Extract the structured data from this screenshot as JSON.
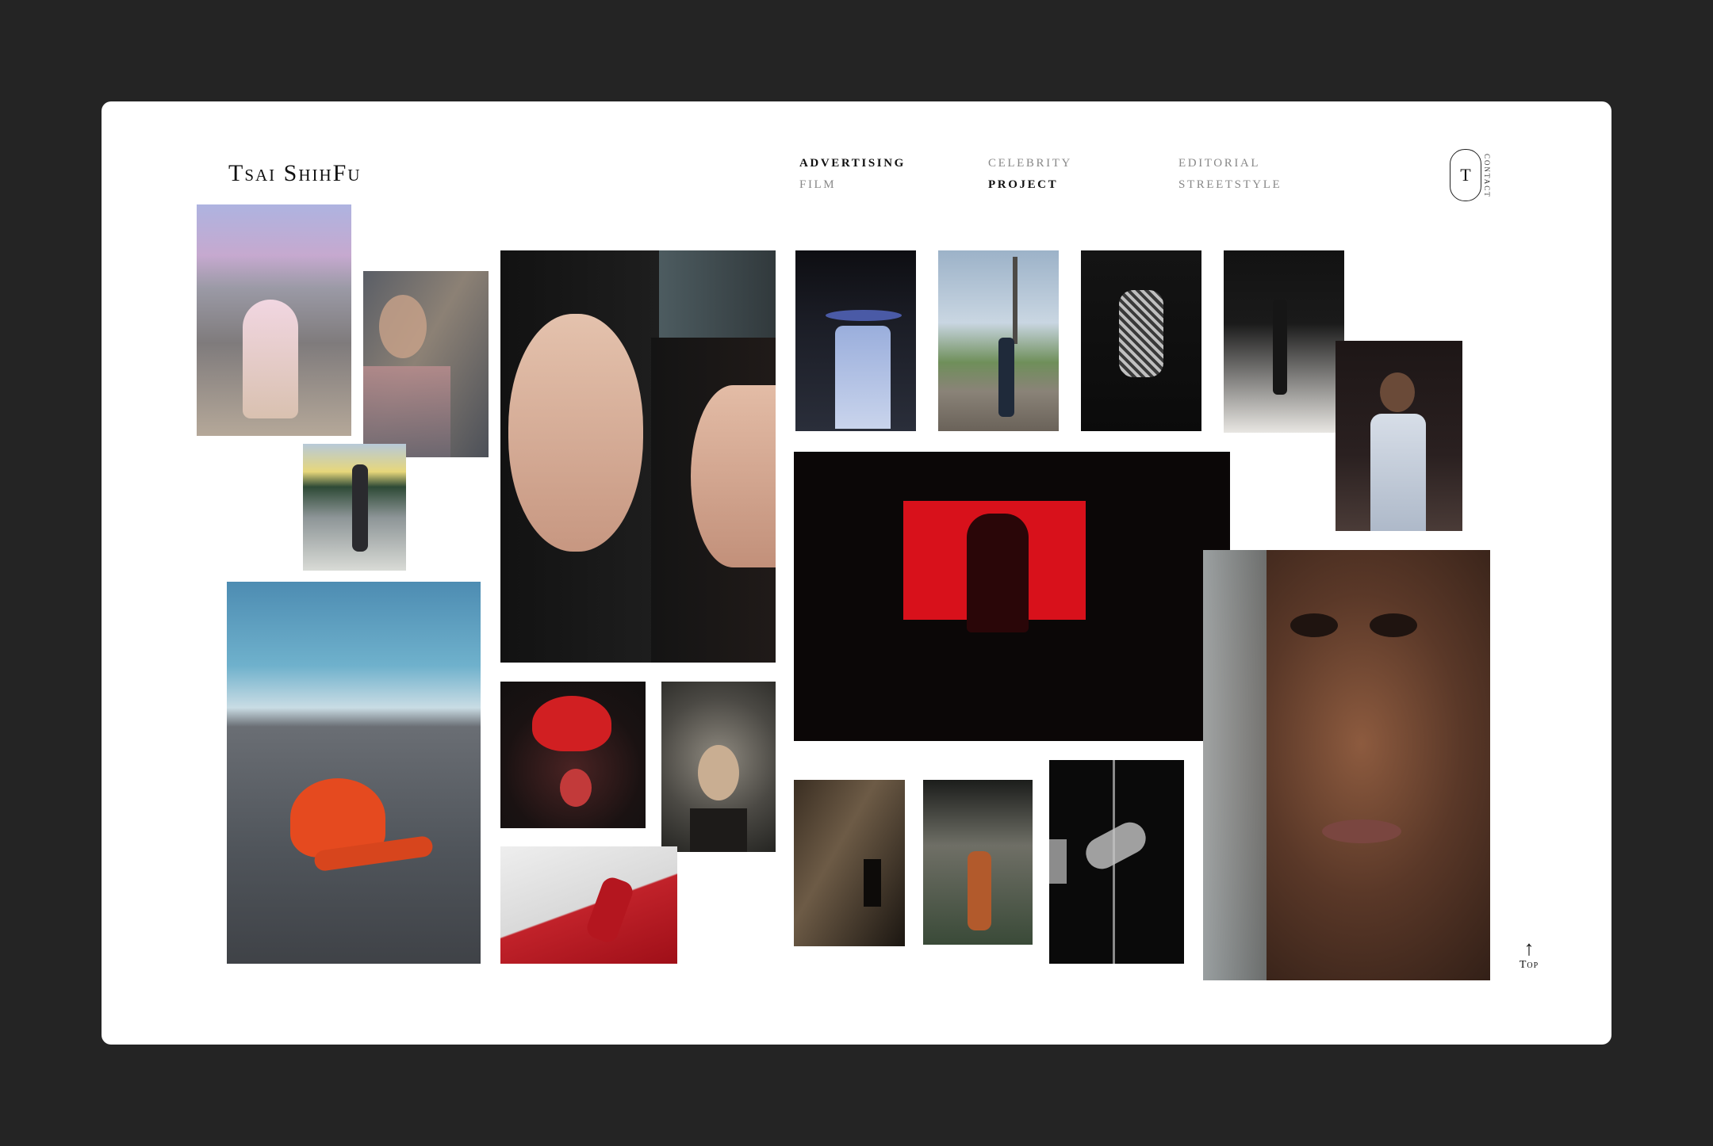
{
  "site": {
    "logo": "Tsai ShihFu"
  },
  "nav": {
    "advertising": "ADVERTISING",
    "film": "FILM",
    "celebrity": "CELEBRITY",
    "project": "PROJECT",
    "editorial": "EDITORIAL",
    "streetstyle": "STREETSTYLE"
  },
  "header": {
    "badge_letter": "T",
    "contact_label": "CONTACT"
  },
  "footer": {
    "top_arrow": "↑",
    "top_label": "Top"
  },
  "colors": {
    "page_background": "#242424",
    "card_background": "#ffffff",
    "accent_red": "#d8111b"
  }
}
